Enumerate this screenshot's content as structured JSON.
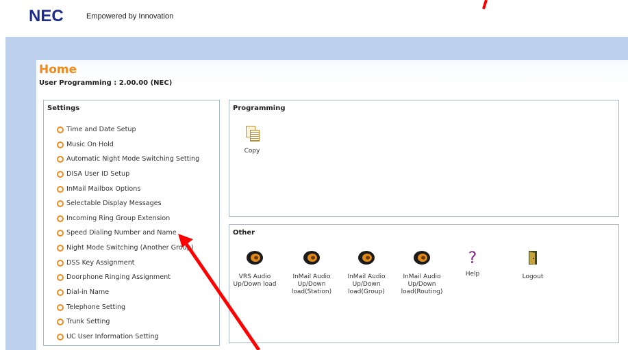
{
  "header": {
    "logo": "NEC",
    "tagline": "Empowered by Innovation"
  },
  "page": {
    "title": "Home",
    "version": "User Programming : 2.00.00 (NEC)"
  },
  "settings": {
    "title": "Settings",
    "items": [
      "Time and Date Setup",
      "Music On Hold",
      "Automatic Night Mode Switching Setting",
      "DISA User ID Setup",
      "InMail Mailbox Options",
      "Selectable Display Messages",
      "Incoming Ring Group Extension",
      "Speed Dialing Number and Name",
      "Night Mode Switching (Another Group)",
      "DSS Key Assignment",
      "Doorphone Ringing Assignment",
      "Dial-in Name",
      "Telephone Setting",
      "Trunk Setting",
      "UC User Information Setting"
    ]
  },
  "programming": {
    "title": "Programming",
    "copy": {
      "label": "Copy",
      "icon": "copy-icon"
    }
  },
  "other": {
    "title": "Other",
    "tools": [
      {
        "label": "VRS Audio Up/Down load",
        "icon": "speaker-icon"
      },
      {
        "label": "InMail Audio Up/Down load(Station)",
        "icon": "speaker-icon"
      },
      {
        "label": "InMail Audio Up/Down load(Group)",
        "icon": "speaker-icon"
      },
      {
        "label": "InMail Audio Up/Down load(Routing)",
        "icon": "speaker-icon"
      },
      {
        "label": "Help",
        "icon": "question-icon"
      },
      {
        "label": "Logout",
        "icon": "door-icon"
      }
    ]
  },
  "colors": {
    "accent": "#f08a1c",
    "brand": "#1c2b8c",
    "frame": "#bdd0ec",
    "annotation": "#ff0000"
  }
}
